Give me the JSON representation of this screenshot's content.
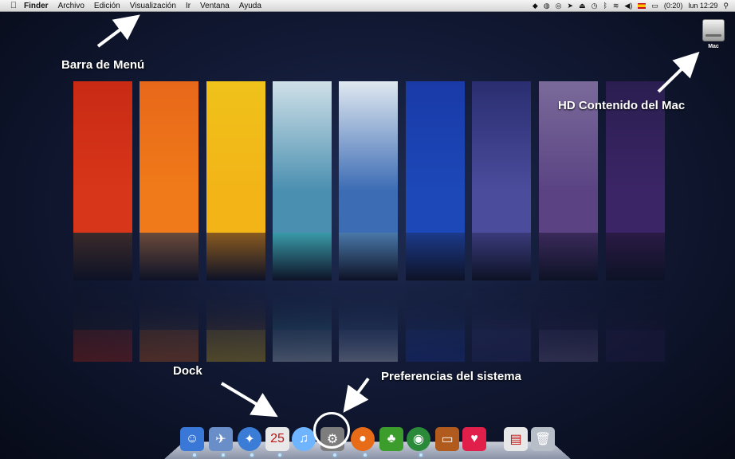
{
  "menubar": {
    "apple": "",
    "items": [
      "Finder",
      "Archivo",
      "Edición",
      "Visualización",
      "Ir",
      "Ventana",
      "Ayuda"
    ],
    "status": {
      "battery": "(0:20)",
      "clock": "lun 12:29",
      "icons": [
        "dropbox-icon",
        "globe-icon",
        "sync-icon",
        "send-icon",
        "eject-icon",
        "time-machine-icon",
        "bluetooth-icon",
        "wifi-icon",
        "volume-icon",
        "flag-es-icon",
        "battery-icon",
        "spotlight-icon"
      ]
    }
  },
  "annotations": {
    "menu_bar": "Barra de Menú",
    "hd": "HD Contenido del Mac",
    "dock": "Dock",
    "prefs": "Preferencias del sistema"
  },
  "desktop_items": {
    "drive_label": "Mac"
  },
  "wallpaper": {
    "panel_colors": [
      "#d8361a",
      "#f07a19",
      "#f2b417",
      "#4a8fb0",
      "#3c6cb4",
      "#1c48b8",
      "#4b4c9c",
      "#5b4383",
      "#3b2566"
    ]
  },
  "dock": {
    "items": [
      {
        "name": "finder",
        "color": "#3a78d8",
        "glyph": "☺"
      },
      {
        "name": "mail",
        "color": "#6a8ec8",
        "glyph": "✈"
      },
      {
        "name": "safari",
        "color": "#3b7dd6",
        "glyph": "✦"
      },
      {
        "name": "ical",
        "color": "#e8e8e8",
        "glyph": "25"
      },
      {
        "name": "itunes",
        "color": "#6fb4ff",
        "glyph": "♫"
      },
      {
        "name": "system-preferences",
        "color": "#7d7d7d",
        "glyph": "⚙"
      },
      {
        "name": "firefox",
        "color": "#e86b17",
        "glyph": "●"
      },
      {
        "name": "adium",
        "color": "#3c9d2d",
        "glyph": "♣"
      },
      {
        "name": "vuze",
        "color": "#2a8a3a",
        "glyph": "◉"
      },
      {
        "name": "keynote",
        "color": "#b05a1e",
        "glyph": "▭"
      },
      {
        "name": "heart-app",
        "color": "#e0204a",
        "glyph": "♥"
      },
      {
        "name": "documents",
        "color": "#e8e8e8",
        "glyph": "▤"
      },
      {
        "name": "trash",
        "color": "#b8bec8",
        "glyph": "🗑"
      }
    ]
  }
}
